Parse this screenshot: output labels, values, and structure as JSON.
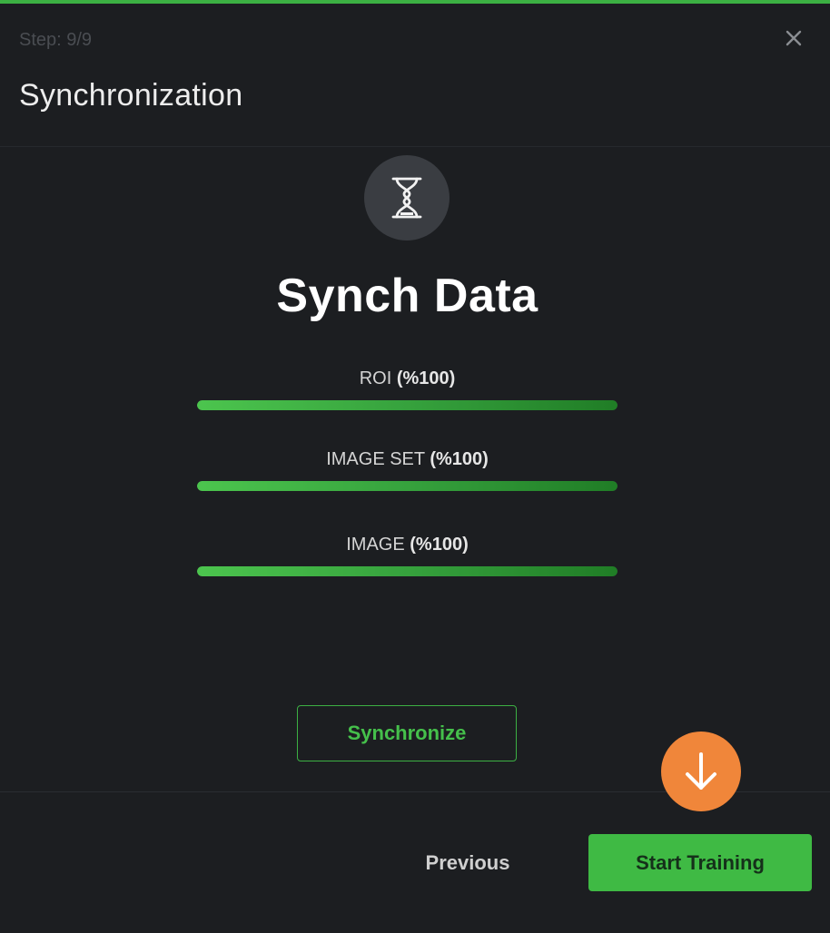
{
  "header": {
    "step": "Step: 9/9",
    "title": "Synchronization",
    "close_icon": "close-icon"
  },
  "main": {
    "icon": "hourglass-icon",
    "heading": "Synch Data",
    "progress": [
      {
        "name": "ROI",
        "percent_text": "(%100)",
        "value": 100
      },
      {
        "name": "IMAGE SET",
        "percent_text": "(%100)",
        "value": 100
      },
      {
        "name": "IMAGE",
        "percent_text": "(%100)",
        "value": 100
      }
    ],
    "sync_button": "Synchronize"
  },
  "footer": {
    "previous_button": "Previous",
    "start_button": "Start Training",
    "hint_icon": "arrow-down-icon"
  },
  "colors": {
    "accent": "#3cb043",
    "hint": "#f0863a",
    "background": "#1c1e21"
  }
}
